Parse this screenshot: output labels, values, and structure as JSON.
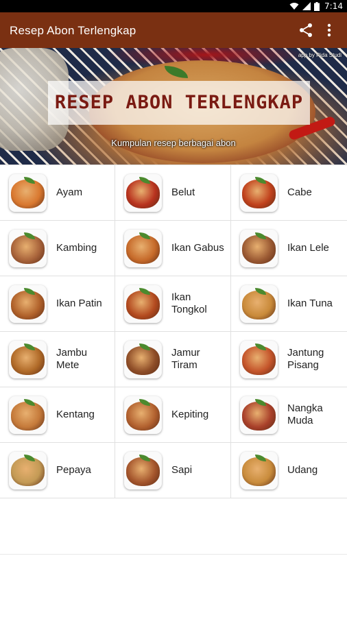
{
  "status_bar": {
    "time": "7:14",
    "icons": [
      "wifi-icon",
      "signal-icon",
      "battery-icon"
    ]
  },
  "app_bar": {
    "title": "Resep Abon Terlengkap",
    "actions": [
      "share-icon",
      "more-vert-icon"
    ],
    "color": "#7a3012"
  },
  "banner": {
    "title": "RESEP ABON TERLENGKAP",
    "subtitle": "Kumpulan resep berbagai abon",
    "credit": "app by Rida Studi"
  },
  "grid": {
    "items": [
      {
        "label": "Ayam",
        "food_color": "#d9782f"
      },
      {
        "label": "Belut",
        "food_color": "#b8321e"
      },
      {
        "label": "Cabe",
        "food_color": "#c0411c"
      },
      {
        "label": "Kambing",
        "food_color": "#a8633a"
      },
      {
        "label": "Ikan Gabus",
        "food_color": "#c66a2a"
      },
      {
        "label": "Ikan Lele",
        "food_color": "#9b5a33"
      },
      {
        "label": "Ikan Patin",
        "food_color": "#b0612a"
      },
      {
        "label": "Ikan Tongkol",
        "food_color": "#b34a1f"
      },
      {
        "label": "Ikan Tuna",
        "food_color": "#c98a3a"
      },
      {
        "label": "Jambu Mete",
        "food_color": "#b06a28"
      },
      {
        "label": "Jamur Tiram",
        "food_color": "#8f4e28"
      },
      {
        "label": "Jantung Pisang",
        "food_color": "#c4542a"
      },
      {
        "label": "Kentang",
        "food_color": "#c57a3a"
      },
      {
        "label": "Kepiting",
        "food_color": "#b2612f"
      },
      {
        "label": "Nangka Muda",
        "food_color": "#a9402a"
      },
      {
        "label": "Pepaya",
        "food_color": "#c39a55"
      },
      {
        "label": "Sapi",
        "food_color": "#a4552c"
      },
      {
        "label": "Udang",
        "food_color": "#c98c3c"
      }
    ]
  }
}
